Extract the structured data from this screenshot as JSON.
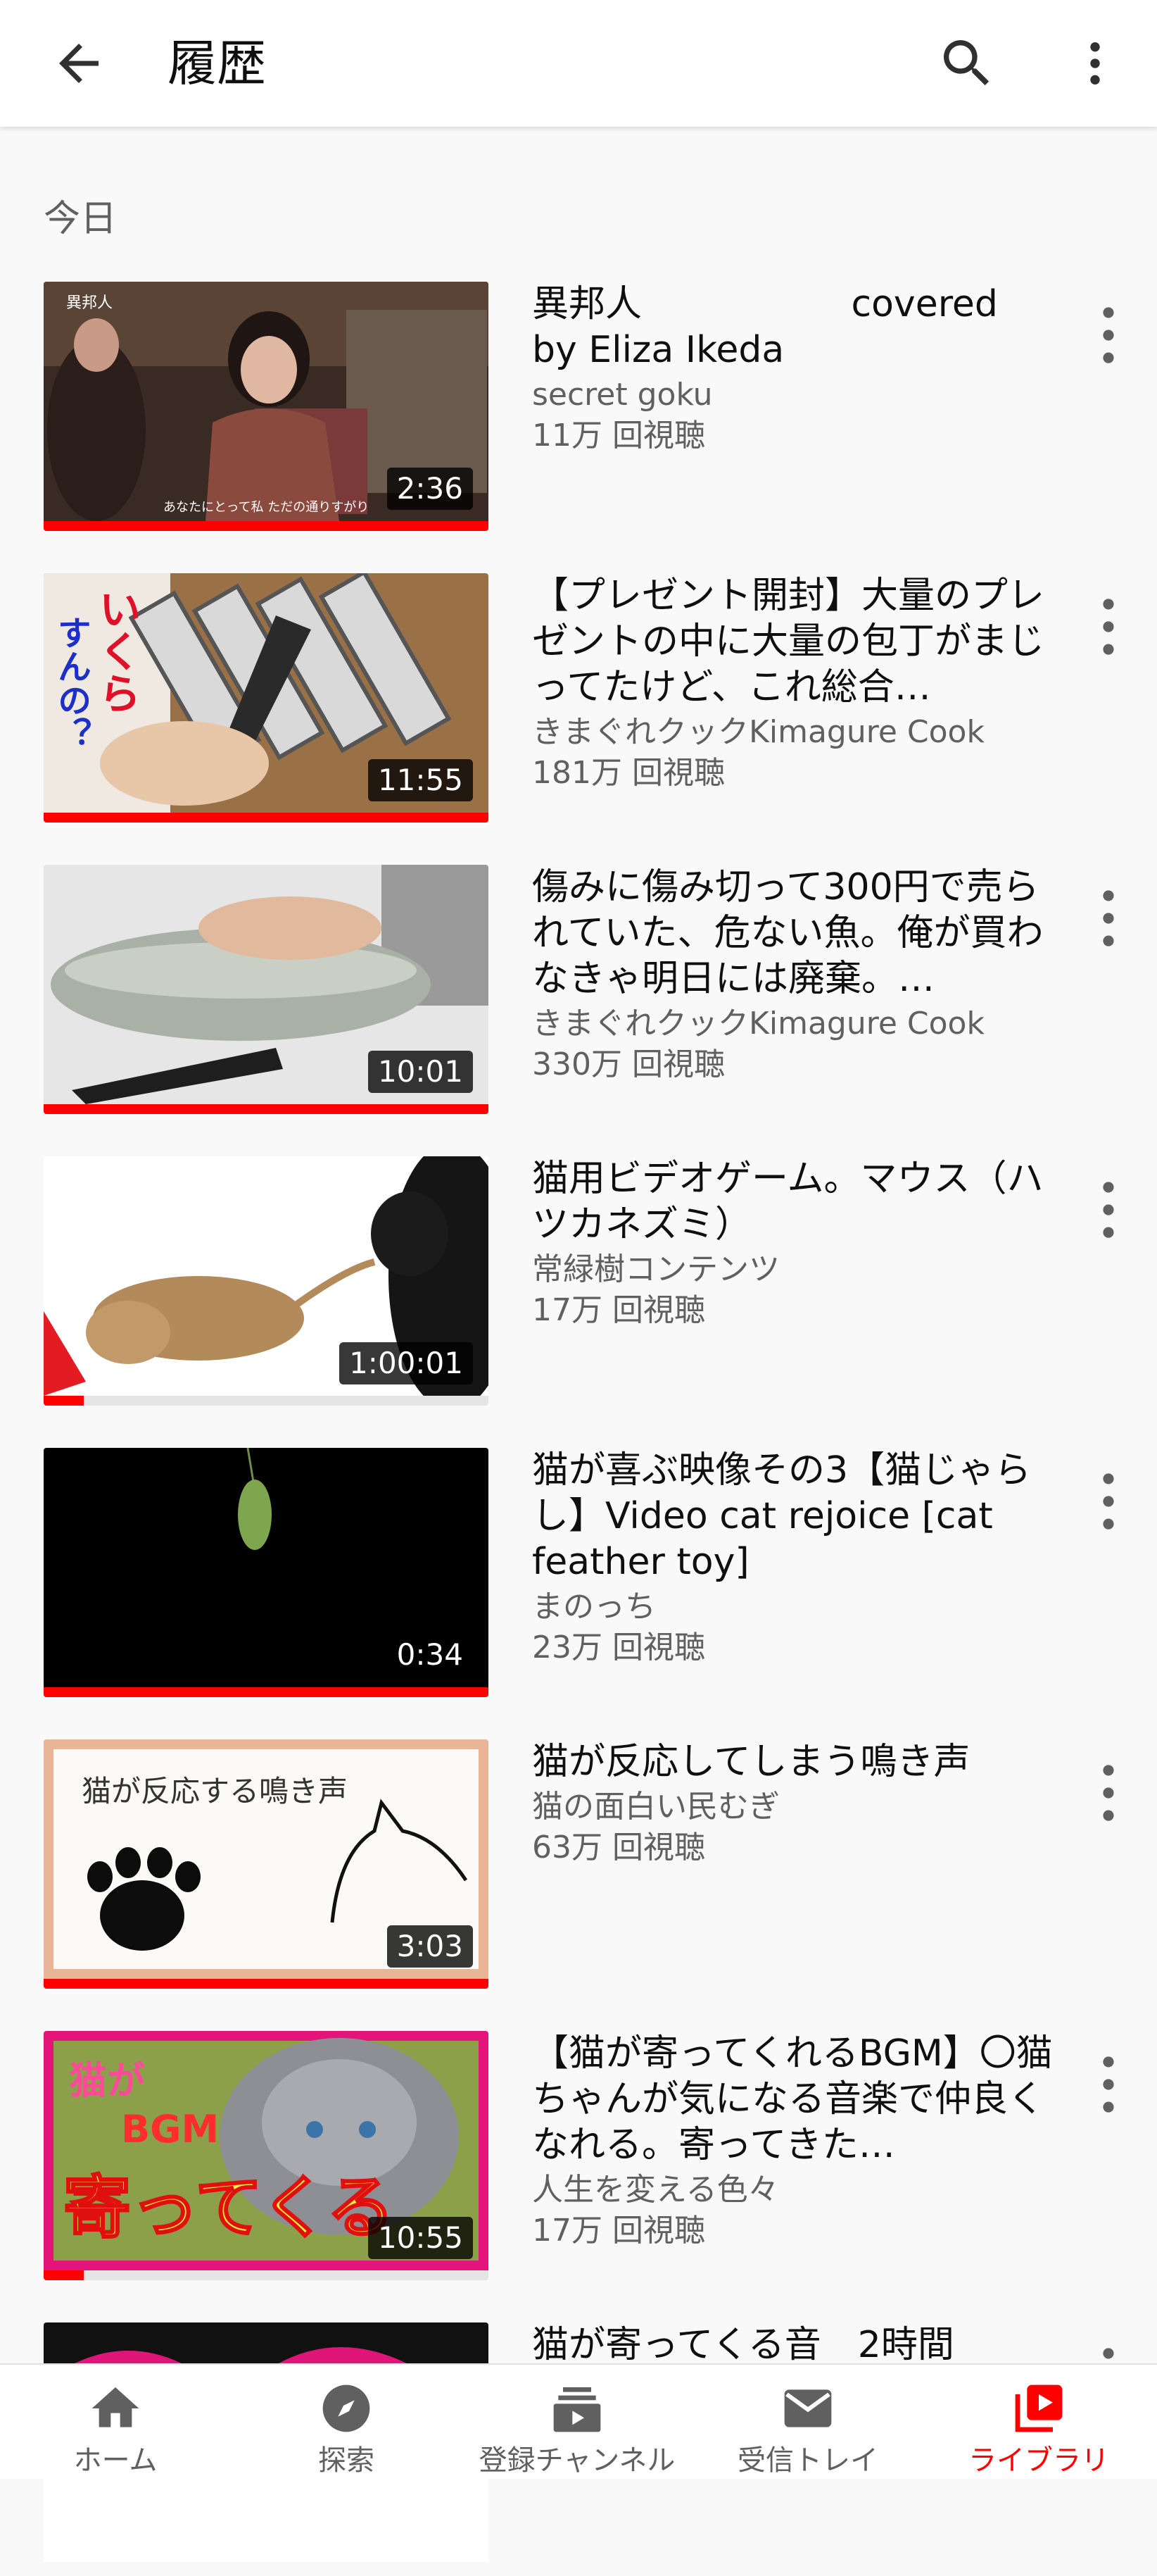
{
  "app_bar": {
    "title": "履歴",
    "back_icon": "arrow-back-icon",
    "search_icon": "search-icon",
    "more_icon": "more-vert-icon"
  },
  "section": {
    "heading": "今日"
  },
  "videos": [
    {
      "title": "異邦人                  covered by Eliza Ikeda",
      "channel": "secret goku",
      "views": "11万 回視聴",
      "duration": "2:36",
      "watched_fraction": 1.0
    },
    {
      "title": "【プレゼント開封】大量のプレゼントの中に大量の包丁がまじってたけど、これ総合…",
      "channel": "きまぐれクックKimagure Cook",
      "views": "181万 回視聴",
      "duration": "11:55",
      "watched_fraction": 1.0
    },
    {
      "title": "傷みに傷み切って300円で売られていた、危ない魚。俺が買わなきゃ明日には廃棄。…",
      "channel": "きまぐれクックKimagure Cook",
      "views": "330万 回視聴",
      "duration": "10:01",
      "watched_fraction": 1.0
    },
    {
      "title": "猫用ビデオゲーム。マウス（ハツカネズミ）",
      "channel": "常緑樹コンテンツ",
      "views": "17万 回視聴",
      "duration": "1:00:01",
      "watched_fraction": 0.09
    },
    {
      "title": "猫が喜ぶ映像その3【猫じゃらし】Video cat rejoice [cat feather toy]",
      "channel": "まのっち",
      "views": "23万 回視聴",
      "duration": "0:34",
      "watched_fraction": 1.0
    },
    {
      "title": "猫が反応してしまう鳴き声",
      "channel": "猫の面白い民むぎ",
      "views": "63万 回視聴",
      "duration": "3:03",
      "watched_fraction": 1.0
    },
    {
      "title": "【猫が寄ってくれるBGM】〇猫ちゃんが気になる音楽で仲良くなれる。寄ってきた…",
      "channel": "人生を変える色々",
      "views": "17万 回視聴",
      "duration": "10:55",
      "watched_fraction": 0.09
    },
    {
      "title": "猫が寄ってくる音　2時間",
      "channel": "",
      "views": "",
      "duration": "",
      "watched_fraction": 0
    }
  ],
  "thumb_text": {
    "t1_caption": "あなたにとって私 ただの通りすがり",
    "t1_tag": "異邦人",
    "t2_overlay": "いくら",
    "t2_overlay2": "すんの？",
    "t6_caption": "猫が反応する鳴き声",
    "t7_line1": "猫が",
    "t7_line2": "BGM",
    "t7_line3": "寄ってくる"
  },
  "bottom_nav": [
    {
      "label": "ホーム",
      "icon": "home-icon",
      "active": false
    },
    {
      "label": "探索",
      "icon": "explore-icon",
      "active": false
    },
    {
      "label": "登録チャンネル",
      "icon": "subscriptions-icon",
      "active": false
    },
    {
      "label": "受信トレイ",
      "icon": "inbox-icon",
      "active": false
    },
    {
      "label": "ライブラリ",
      "icon": "library-icon",
      "active": true
    }
  ],
  "colors": {
    "accent": "#ff0000",
    "secondary_text": "#606060",
    "primary_text": "#0f0f0f",
    "background": "#f9f9f9"
  }
}
